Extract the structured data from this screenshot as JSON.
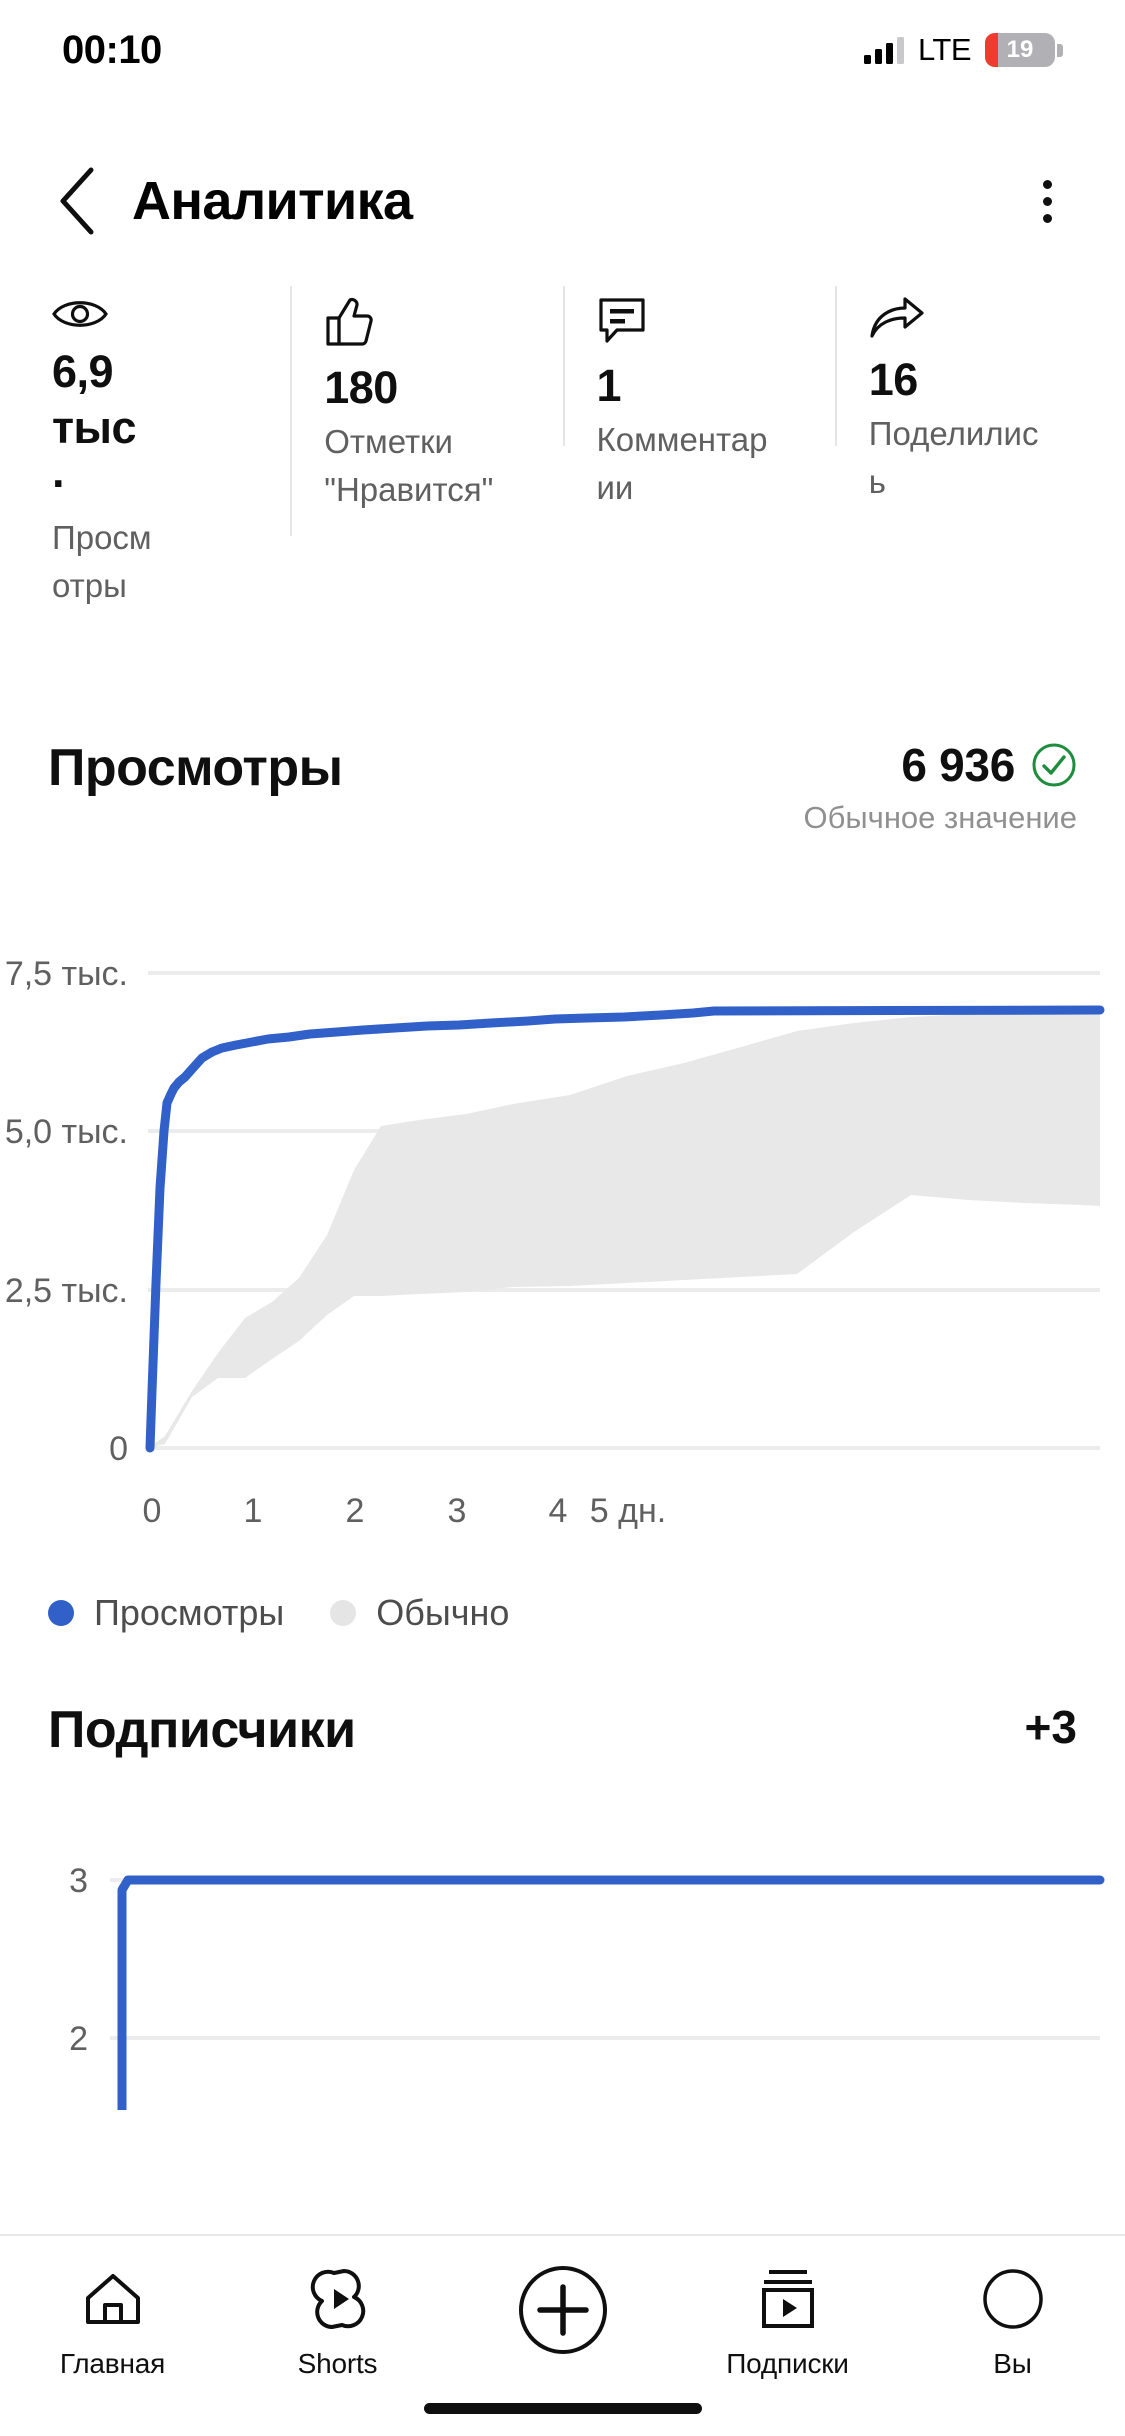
{
  "status_bar": {
    "time": "00:10",
    "network": "LTE",
    "battery_percent": "19",
    "signal_icon": "cellular-signal-icon",
    "battery_icon": "battery-low-icon"
  },
  "header": {
    "back_icon": "chevron-left-icon",
    "title": "Аналитика",
    "menu_icon": "kebab-menu-icon"
  },
  "stats": [
    {
      "icon": "eye-icon",
      "value": "6,9 тыс ·",
      "label": "Просмотры"
    },
    {
      "icon": "thumbs-up-icon",
      "value": "180",
      "label": "Отметки \"Нравится\""
    },
    {
      "icon": "comment-icon",
      "value": "1",
      "label": "Комментарии"
    },
    {
      "icon": "share-icon",
      "value": "16",
      "label": "Поделились"
    }
  ],
  "views_section": {
    "title": "Просмотры",
    "value": "6 936",
    "status_icon": "check-circle-icon",
    "status_color": "#1e8e3e",
    "subtitle": "Обычное значение",
    "legend": [
      {
        "label": "Просмотры",
        "color": "#3060c8",
        "icon": "legend-dot-blue"
      },
      {
        "label": "Обычно",
        "color": "#e5e5e5",
        "icon": "legend-dot-gray"
      }
    ]
  },
  "subs_section": {
    "title": "Подписчики",
    "delta": "+3"
  },
  "bottom_nav": [
    {
      "icon": "home-icon",
      "label": "Главная"
    },
    {
      "icon": "shorts-icon",
      "label": "Shorts"
    },
    {
      "icon": "create-plus-icon",
      "label": ""
    },
    {
      "icon": "subscriptions-icon",
      "label": "Подписки"
    },
    {
      "icon": "account-avatar-icon",
      "label": "Вы"
    }
  ],
  "chart_data": [
    {
      "type": "area",
      "name": "views-chart",
      "title": "Просмотры",
      "xlabel": "дн.",
      "ylabel": "",
      "xlim": [
        0,
        5.45
      ],
      "ylim": [
        0,
        7500
      ],
      "ytick_labels": [
        "7,5 тыс.",
        "5,0 тыс.",
        "2,5 тыс.",
        "0"
      ],
      "ytick_values": [
        7500,
        5000,
        2500,
        0
      ],
      "xtick_labels": [
        "0",
        "1",
        "2",
        "3",
        "4",
        "5 дн."
      ],
      "xtick_values": [
        0,
        1,
        2,
        3,
        4,
        5
      ],
      "grid": true,
      "legend": "below",
      "series": [
        {
          "name": "Просмотры",
          "color": "#3060c8",
          "x": [
            0.0,
            0.02,
            0.04,
            0.06,
            0.08,
            0.1,
            0.14,
            0.18,
            0.24,
            0.3,
            0.38,
            0.46,
            0.55,
            0.66,
            0.8,
            0.95,
            1.1,
            1.3,
            1.5,
            1.75,
            2.0,
            2.3,
            2.6,
            2.9,
            3.2,
            3.55,
            3.8,
            4.1,
            4.45,
            4.8,
            5.1,
            5.3,
            5.45
          ],
          "y": [
            0,
            900,
            2600,
            4100,
            5000,
            5450,
            5600,
            5700,
            5790,
            5880,
            6020,
            6180,
            6280,
            6340,
            6390,
            6440,
            6480,
            6520,
            6560,
            6590,
            6620,
            6660,
            6690,
            6710,
            6730,
            6760,
            6790,
            6810,
            6830,
            6850,
            6880,
            6920,
            6936
          ]
        },
        {
          "name": "Обычно",
          "color": "#e5e5e5",
          "type": "band",
          "x": [
            0.0,
            0.1,
            0.25,
            0.4,
            0.55,
            0.7,
            0.85,
            1.0,
            1.15,
            1.3,
            1.5,
            1.75,
            2.0,
            2.3,
            2.6,
            2.9,
            3.2,
            3.5,
            3.8,
            4.1,
            4.4,
            4.7,
            5.0,
            5.25,
            5.45
          ],
          "upper": [
            0,
            200,
            900,
            1500,
            2000,
            2300,
            2700,
            3400,
            4400,
            5100,
            5200,
            5300,
            5450,
            5600,
            5900,
            6100,
            6350,
            6600,
            6750,
            6850,
            6900,
            6960,
            7000,
            7050,
            7080
          ],
          "lower": [
            0,
            60,
            250,
            600,
            1100,
            1400,
            1700,
            1900,
            2100,
            2250,
            2400,
            2450,
            2500,
            2550,
            2600,
            2650,
            2700,
            2750,
            3000,
            3400,
            3600,
            3700,
            3750,
            3800,
            3820
          ]
        }
      ]
    },
    {
      "type": "line",
      "name": "subscribers-chart",
      "title": "Подписчики",
      "xlabel": "",
      "ylabel": "",
      "ylim": [
        1.35,
        3.18
      ],
      "ytick_labels": [
        "3",
        "2"
      ],
      "ytick_values": [
        3,
        2
      ],
      "grid": true,
      "series": [
        {
          "name": "Подписчики",
          "color": "#3060c8",
          "x": [
            0.0,
            0.055,
            0.075,
            5.45
          ],
          "y": [
            1.35,
            1.4,
            3.0,
            3.0
          ]
        }
      ]
    }
  ]
}
